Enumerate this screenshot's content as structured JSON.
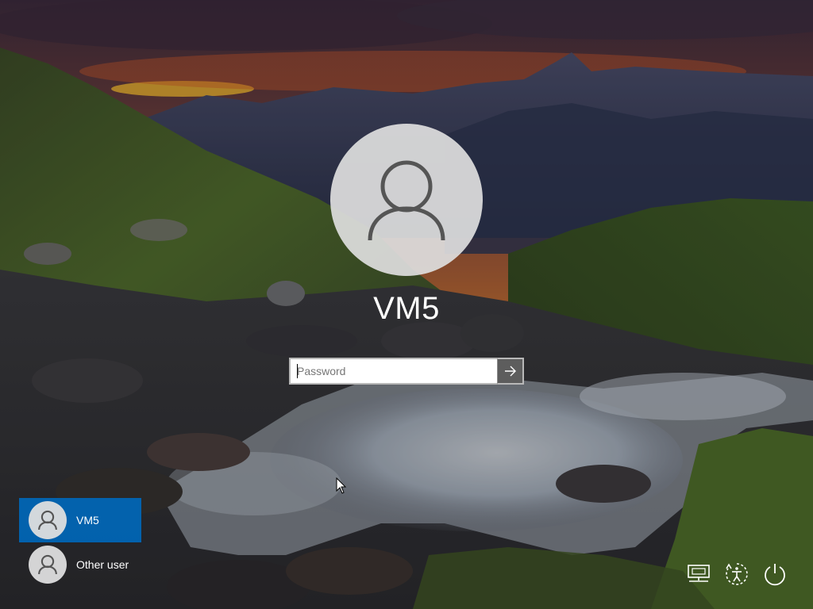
{
  "lock_screen": {
    "username": "VM5",
    "password_placeholder": "Password"
  },
  "user_list": [
    {
      "name": "VM5",
      "selected": true
    },
    {
      "name": "Other user",
      "selected": false
    }
  ],
  "system_buttons": [
    "network-icon",
    "ease-of-access-icon",
    "power-icon"
  ],
  "colors": {
    "selected_user_bg": "#0067b8",
    "avatar_bg": "#dedede",
    "avatar_glyph": "#555555",
    "submit_button_bg": "#5d5d5d"
  }
}
